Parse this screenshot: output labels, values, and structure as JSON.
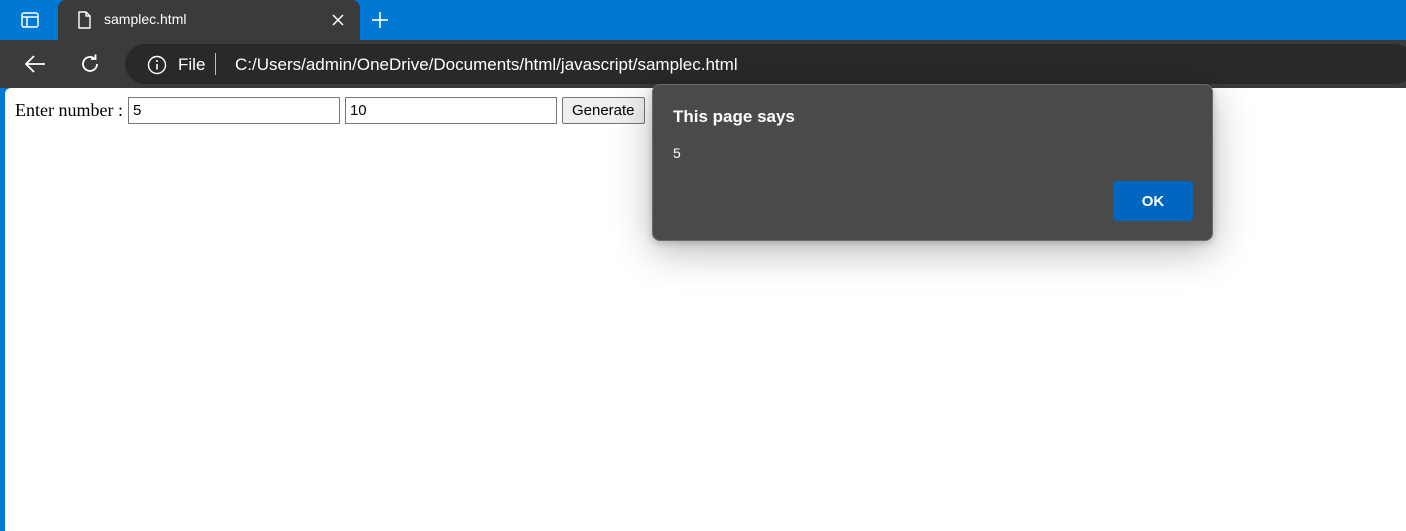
{
  "browser": {
    "tab": {
      "title": "samplec.html"
    },
    "address": {
      "scheme": "File",
      "url": "C:/Users/admin/OneDrive/Documents/html/javascript/samplec.html"
    }
  },
  "page": {
    "label": "Enter number :",
    "input1_value": "5",
    "input2_value": "10",
    "button_label": "Generate"
  },
  "dialog": {
    "title": "This page says",
    "message": "5",
    "ok_label": "OK"
  },
  "colors": {
    "accent": "#0078d4",
    "ok_button": "#0067c0",
    "dialog_bg": "#4a4a4a",
    "toolbar_bg": "#3b3b3b"
  },
  "icons": [
    "tab-actions-icon",
    "file-icon",
    "close-icon",
    "plus-icon",
    "back-arrow-icon",
    "reload-icon",
    "info-icon"
  ]
}
